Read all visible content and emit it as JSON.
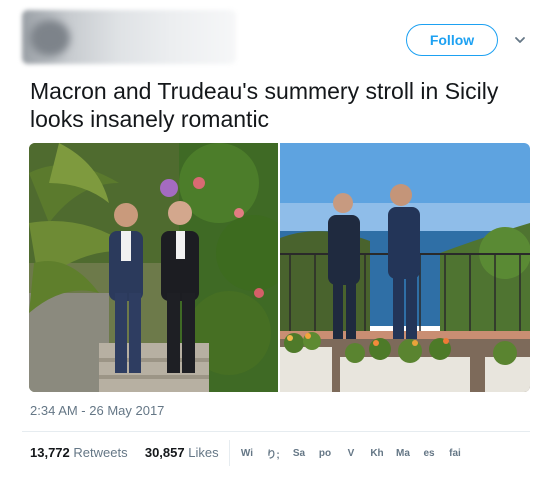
{
  "header": {
    "follow_label": "Follow",
    "chevron_icon": "chevron-down-icon"
  },
  "tweet": {
    "text": "Macron and Trudeau's summery stroll in Sicily looks insanely romantic",
    "timestamp": "2:34 AM - 26 May 2017"
  },
  "stats": {
    "retweets_count": "13,772",
    "retweets_label": "Retweets",
    "likes_count": "30,857",
    "likes_label": "Likes"
  },
  "likers": [
    "Wi",
    "り;",
    "Sa",
    "po",
    "V",
    "Kh",
    "Mа",
    "es",
    "fai"
  ],
  "colors": {
    "accent": "#1da1f2",
    "text": "#14171a",
    "muted": "#657786",
    "border": "#e6ecf0"
  }
}
